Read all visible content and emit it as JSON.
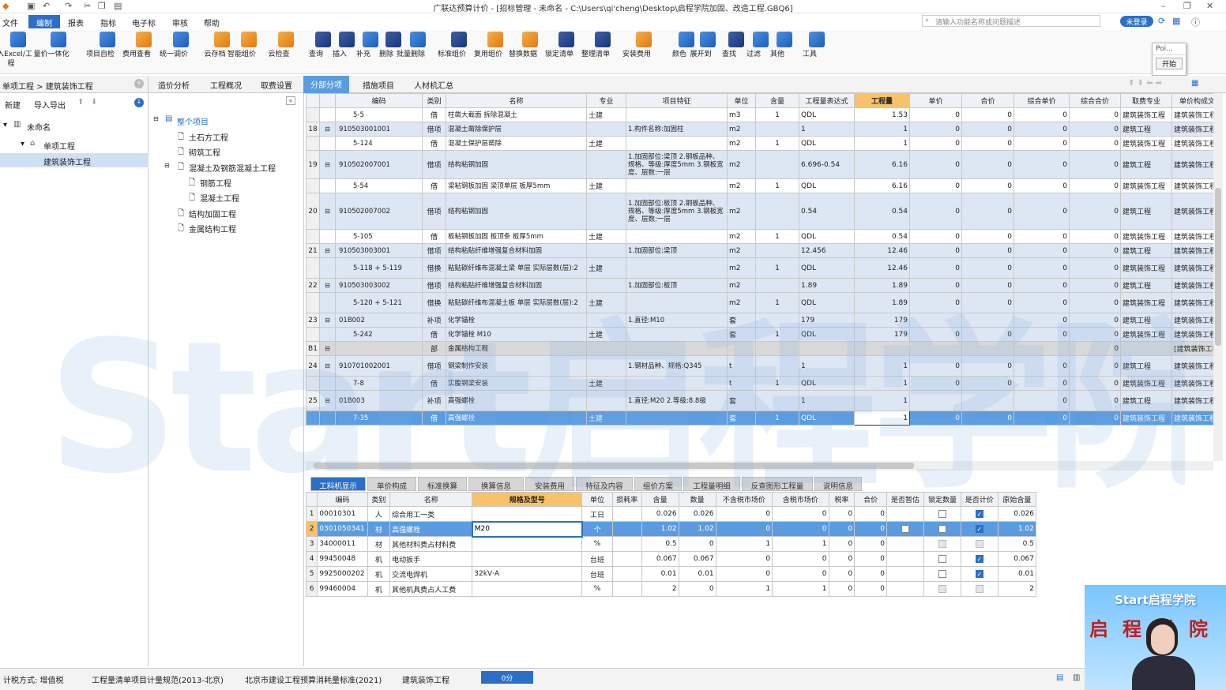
{
  "title": "广联达预算计价 - [招标管理 - 未命名 - C:\\Users\\qi'cheng\\Desktop\\启程学院加固、改造工程.GBQ6]",
  "menu": [
    "文件",
    "编制",
    "报表",
    "指标",
    "电子标",
    "审核",
    "帮助"
  ],
  "search_placeholder": "请输入功能名称或问题描述",
  "login_label": "未登录",
  "ribbon": [
    "导入Excel/工程",
    "量价一体化",
    "项目自检",
    "费用查看",
    "统一调价",
    "云存档",
    "智能组价",
    "云检查",
    "查询",
    "插入",
    "补充",
    "删除",
    "批量删除",
    "标准组价",
    "复用组价",
    "替换数据",
    "锁定清单",
    "整理清单",
    "安装费用",
    "颜色",
    "展开到",
    "查找",
    "过滤",
    "其他",
    "工具"
  ],
  "popup": {
    "item": "Poi...",
    "button": "开始"
  },
  "breadcrumb": "单项工程 > 建筑装饰工程",
  "left_toolbar": {
    "new": "新建",
    "import": "导入导出"
  },
  "project_tree": {
    "root": "未命名",
    "child": "单项工程",
    "leaf": "建筑装饰工程"
  },
  "section_tree": {
    "root": "整个项目",
    "items": [
      "土石方工程",
      "砌筑工程",
      "混凝土及钢筋混凝土工程",
      "钢筋工程",
      "混凝土工程",
      "结构加固工程",
      "金属结构工程"
    ]
  },
  "tabs": [
    "造价分析",
    "工程概况",
    "取费设置",
    "分部分项",
    "措施项目",
    "人材机汇总"
  ],
  "grid": {
    "headers": [
      "编码",
      "类别",
      "名称",
      "专业",
      "项目特征",
      "单位",
      "含量",
      "工程量表达式",
      "工程量",
      "单价",
      "合价",
      "综合单价",
      "综合合价",
      "取费专业",
      "单价构成文件"
    ],
    "rows": [
      {
        "no": "",
        "code": "5-5",
        "type": "借",
        "name": "柱凿大截面 拆除混凝土",
        "spec": "土建",
        "feature": "",
        "unit": "m3",
        "ratio": "1",
        "expr": "QDL",
        "qty": "1.53",
        "price": "0",
        "total": "0",
        "uprice": "0",
        "utotal": "0",
        "fee": "建筑装饰工程",
        "file": "建筑装饰工程",
        "kind": "white",
        "indent": 2
      },
      {
        "no": "18",
        "code": "910503001001",
        "type": "借项",
        "name": "混凝土凿除保护层",
        "spec": "",
        "feature": "1.构件名称:加固柱",
        "unit": "m2",
        "ratio": "",
        "expr": "1",
        "qty": "1",
        "price": "0",
        "total": "0",
        "uprice": "0",
        "utotal": "0",
        "fee": "建筑工程",
        "file": "建筑装饰工程",
        "kind": "blue",
        "indent": 1
      },
      {
        "no": "",
        "code": "5-124",
        "type": "借",
        "name": "混凝土保护层凿除",
        "spec": "土建",
        "feature": "",
        "unit": "m2",
        "ratio": "1",
        "expr": "QDL",
        "qty": "1",
        "price": "0",
        "total": "0",
        "uprice": "0",
        "utotal": "0",
        "fee": "建筑装饰工程",
        "file": "建筑装饰工程",
        "kind": "white",
        "indent": 2
      },
      {
        "no": "19",
        "code": "910502007001",
        "type": "借项",
        "name": "结构粘钢加固",
        "spec": "",
        "feature": "1.加固部位:梁顶 2.钢板品种、规格、等级:厚度5mm 3.钢板宽度、层数:一层",
        "unit": "m2",
        "ratio": "",
        "expr": "6.696-0.54",
        "qty": "6.16",
        "price": "0",
        "total": "0",
        "uprice": "0",
        "utotal": "0",
        "fee": "建筑工程",
        "file": "建筑装饰工程",
        "kind": "blue",
        "indent": 1,
        "tall": 3
      },
      {
        "no": "",
        "code": "5-54",
        "type": "借",
        "name": "梁粘钢板加固 梁顶单层 板厚5mm",
        "spec": "土建",
        "feature": "",
        "unit": "m2",
        "ratio": "1",
        "expr": "QDL",
        "qty": "6.16",
        "price": "0",
        "total": "0",
        "uprice": "0",
        "utotal": "0",
        "fee": "建筑装饰工程",
        "file": "建筑装饰工程",
        "kind": "white",
        "indent": 2
      },
      {
        "no": "20",
        "code": "910502007002",
        "type": "借项",
        "name": "结构粘钢加固",
        "spec": "",
        "feature": "1.加固部位:板顶 2.钢板品种、规格、等级:厚度5mm 3.钢板宽度、层数:一层",
        "unit": "m2",
        "ratio": "",
        "expr": "0.54",
        "qty": "0.54",
        "price": "0",
        "total": "0",
        "uprice": "0",
        "utotal": "0",
        "fee": "建筑工程",
        "file": "建筑装饰工程",
        "kind": "blue",
        "indent": 1,
        "tall": 4
      },
      {
        "no": "",
        "code": "5-105",
        "type": "借",
        "name": "板粘钢板加固 板顶条 板厚5mm",
        "spec": "土建",
        "feature": "",
        "unit": "m2",
        "ratio": "1",
        "expr": "QDL",
        "qty": "0.54",
        "price": "0",
        "total": "0",
        "uprice": "0",
        "utotal": "0",
        "fee": "建筑装饰工程",
        "file": "建筑装饰工程",
        "kind": "white",
        "indent": 2
      },
      {
        "no": "21",
        "code": "910503003001",
        "type": "借项",
        "name": "结构粘贴纤维增强复合材料加固",
        "spec": "",
        "feature": "1.加固部位:梁顶",
        "unit": "m2",
        "ratio": "",
        "expr": "12.456",
        "qty": "12.46",
        "price": "0",
        "total": "0",
        "uprice": "0",
        "utotal": "0",
        "fee": "建筑工程",
        "file": "建筑装饰工程",
        "kind": "blue",
        "indent": 1
      },
      {
        "no": "",
        "code": "5-118 + 5-119",
        "type": "借换",
        "name": "粘贴碳纤维布混凝土梁 单层 实际层数(层):2",
        "spec": "土建",
        "feature": "",
        "unit": "m2",
        "ratio": "1",
        "expr": "QDL",
        "qty": "12.46",
        "price": "0",
        "total": "0",
        "uprice": "0",
        "utotal": "0",
        "fee": "建筑装饰工程",
        "file": "建筑装饰工程",
        "kind": "blue",
        "indent": 2,
        "tall": 2
      },
      {
        "no": "22",
        "code": "910503003002",
        "type": "借项",
        "name": "结构粘贴纤维增强复合材料加固",
        "spec": "",
        "feature": "1.加固部位:板顶",
        "unit": "m2",
        "ratio": "",
        "expr": "1.89",
        "qty": "1.89",
        "price": "0",
        "total": "0",
        "uprice": "0",
        "utotal": "0",
        "fee": "建筑工程",
        "file": "建筑装饰工程",
        "kind": "blue",
        "indent": 1
      },
      {
        "no": "",
        "code": "5-120 + 5-121",
        "type": "借换",
        "name": "粘贴碳纤维布混凝土板 单层 实际层数(层):2",
        "spec": "土建",
        "feature": "",
        "unit": "m2",
        "ratio": "1",
        "expr": "QDL",
        "qty": "1.89",
        "price": "0",
        "total": "0",
        "uprice": "0",
        "utotal": "0",
        "fee": "建筑装饰工程",
        "file": "建筑装饰工程",
        "kind": "blue",
        "indent": 2,
        "tall": 2
      },
      {
        "no": "23",
        "code": "01B002",
        "type": "补项",
        "name": "化学锚栓",
        "spec": "",
        "feature": "1.直径:M10",
        "unit": "套",
        "ratio": "",
        "expr": "179",
        "qty": "179",
        "price": "",
        "total": "",
        "uprice": "0",
        "utotal": "0",
        "fee": "建筑工程",
        "file": "建筑装饰工程",
        "kind": "blue",
        "indent": 1
      },
      {
        "no": "",
        "code": "5-242",
        "type": "借",
        "name": "化学锚栓 M10",
        "spec": "土建",
        "feature": "",
        "unit": "套",
        "ratio": "1",
        "expr": "QDL",
        "qty": "179",
        "price": "0",
        "total": "0",
        "uprice": "0",
        "utotal": "0",
        "fee": "建筑装饰工程",
        "file": "建筑装饰工程",
        "kind": "blue",
        "indent": 2
      },
      {
        "no": "B1",
        "code": "",
        "type": "部",
        "name": "金属结构工程",
        "spec": "",
        "feature": "",
        "unit": "",
        "ratio": "",
        "expr": "",
        "qty": "",
        "price": "",
        "total": "",
        "uprice": "",
        "utotal": "0",
        "fee": "",
        "file": "[建筑装饰工程]",
        "kind": "gray",
        "indent": 0
      },
      {
        "no": "24",
        "code": "910701002001",
        "type": "借项",
        "name": "钢梁制作安装",
        "spec": "",
        "feature": "1.钢材品种、规格:Q345",
        "unit": "t",
        "ratio": "",
        "expr": "1",
        "qty": "1",
        "price": "0",
        "total": "0",
        "uprice": "0",
        "utotal": "0",
        "fee": "建筑工程",
        "file": "建筑装饰工程",
        "kind": "blue",
        "indent": 1,
        "tall": 2
      },
      {
        "no": "",
        "code": "7-8",
        "type": "借",
        "name": "实腹钢梁安装",
        "spec": "土建",
        "feature": "",
        "unit": "t",
        "ratio": "1",
        "expr": "QDL",
        "qty": "1",
        "price": "0",
        "total": "0",
        "uprice": "0",
        "utotal": "0",
        "fee": "建筑装饰工程",
        "file": "建筑装饰工程",
        "kind": "blue",
        "indent": 2
      },
      {
        "no": "25",
        "code": "01B003",
        "type": "补项",
        "name": "高强螺栓",
        "spec": "",
        "feature": "1.直径:M20 2.等级:8.8级",
        "unit": "套",
        "ratio": "",
        "expr": "1",
        "qty": "1",
        "price": "",
        "total": "",
        "uprice": "0",
        "utotal": "0",
        "fee": "建筑工程",
        "file": "建筑装饰工程",
        "kind": "blue",
        "indent": 1,
        "tall": 2
      },
      {
        "no": "",
        "code": "7-35",
        "type": "借",
        "name": "高强螺栓",
        "spec": "土建",
        "feature": "",
        "unit": "套",
        "ratio": "1",
        "expr": "QDL",
        "qty": "1",
        "price": "0",
        "total": "0",
        "uprice": "0",
        "utotal": "0",
        "fee": "建筑装饰工程",
        "file": "建筑装饰工程",
        "kind": "sel",
        "indent": 2
      }
    ]
  },
  "bottom_tabs": [
    "工料机显示",
    "单价构成",
    "标准换算",
    "换算信息",
    "安装费用",
    "特征及内容",
    "组价方案",
    "工程量明细",
    "反查图形工程量",
    "说明信息"
  ],
  "detail": {
    "headers": [
      "编码",
      "类别",
      "名称",
      "规格及型号",
      "单位",
      "损耗率",
      "含量",
      "数量",
      "不含税市场价",
      "含税市场价",
      "税率",
      "合价",
      "是否暂估",
      "锁定数量",
      "是否计价",
      "原始含量"
    ],
    "rows": [
      {
        "no": "1",
        "code": "00010301",
        "type": "人",
        "name": "综合用工一类",
        "model": "",
        "unit": "工日",
        "loss": "",
        "ratio": "0.026",
        "qty": "0.026",
        "p1": "0",
        "p2": "0",
        "tax": "0",
        "total": "0",
        "est": false,
        "lock": "off",
        "calc": "on",
        "orig": "0.026"
      },
      {
        "no": "2",
        "code": "0301050341",
        "type": "材",
        "name": "高强螺栓",
        "model": "M20",
        "unit": "个",
        "loss": "",
        "ratio": "1.02",
        "qty": "1.02",
        "p1": "0",
        "p2": "0",
        "tax": "0",
        "total": "0",
        "est": true,
        "lock": "off",
        "calc": "on",
        "orig": "1.02"
      },
      {
        "no": "3",
        "code": "34000011",
        "type": "材",
        "name": "其他材料费占材料费",
        "model": "",
        "unit": "%",
        "loss": "",
        "ratio": "0.5",
        "qty": "0",
        "p1": "1",
        "p2": "1",
        "tax": "0",
        "total": "0",
        "est": false,
        "lock": "dis",
        "calc": "dis",
        "orig": "0.5"
      },
      {
        "no": "4",
        "code": "99450048",
        "type": "机",
        "name": "电动扳手",
        "model": "",
        "unit": "台班",
        "loss": "",
        "ratio": "0.067",
        "qty": "0.067",
        "p1": "0",
        "p2": "0",
        "tax": "0",
        "total": "0",
        "est": false,
        "lock": "off",
        "calc": "on",
        "orig": "0.067"
      },
      {
        "no": "5",
        "code": "9925000202",
        "type": "机",
        "name": "交流电焊机",
        "model": "32kV·A",
        "unit": "台班",
        "loss": "",
        "ratio": "0.01",
        "qty": "0.01",
        "p1": "0",
        "p2": "0",
        "tax": "0",
        "total": "0",
        "est": false,
        "lock": "off",
        "calc": "on",
        "orig": "0.01"
      },
      {
        "no": "6",
        "code": "99460004",
        "type": "机",
        "name": "其他机具费占人工费",
        "model": "",
        "unit": "%",
        "loss": "",
        "ratio": "2",
        "qty": "0",
        "p1": "1",
        "p2": "1",
        "tax": "0",
        "total": "0",
        "est": false,
        "lock": "dis",
        "calc": "dis",
        "orig": "2"
      }
    ]
  },
  "status": {
    "tax_method": "计税方式: 增值税",
    "spec1": "工程量清单项目计量规范(2013-北京)",
    "spec2": "北京市建设工程预算消耗量标准(2021)",
    "project": "建筑装饰工程",
    "score": "0分"
  },
  "watermark": "Start启程学院",
  "webcam_logo": "Start启程学院",
  "webcam_text": "启程学院",
  "colors": {
    "accent": "#2b6fc7",
    "row_blue": "#dde6f3",
    "row_selected": "#5b9be0",
    "tab_active": "#5b9be0"
  }
}
